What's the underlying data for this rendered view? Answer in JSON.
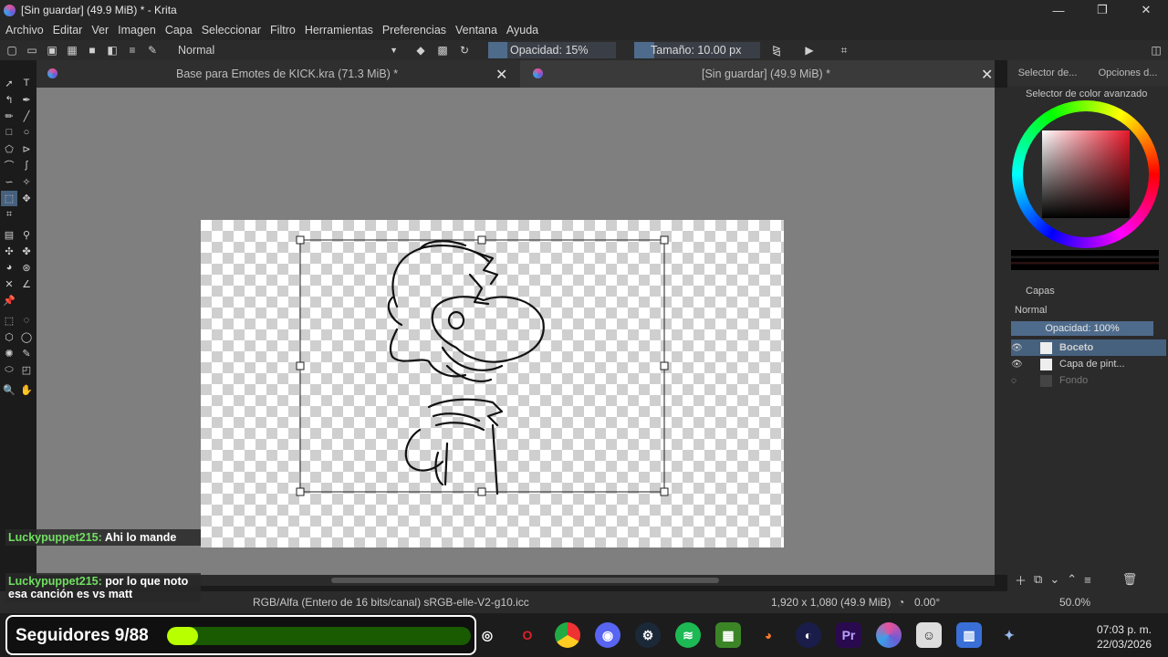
{
  "window": {
    "title": "[Sin guardar]  (49.9 MiB) * - Krita"
  },
  "menu": {
    "items": [
      "Archivo",
      "Editar",
      "Ver",
      "Imagen",
      "Capa",
      "Seleccionar",
      "Filtro",
      "Herramientas",
      "Preferencias",
      "Ventana",
      "Ayuda"
    ]
  },
  "toolbar": {
    "blend_mode": "Normal",
    "opacity_label": "Opacidad: 15%",
    "opacity": 0.15,
    "size_label": "Tamaño: 10.00 px"
  },
  "tabs": [
    {
      "label": "Base para Emotes de KICK.kra (71.3 MiB) *"
    },
    {
      "label": "[Sin guardar]  (49.9 MiB) *"
    }
  ],
  "status": {
    "color_space": "RGB/Alfa (Entero de 16 bits/canal)  sRGB-elle-V2-g10.icc",
    "dimensions": "1,920 x 1,080 (49.9 MiB)",
    "rotation": "0.00°",
    "zoom": "50.0%"
  },
  "dock": {
    "tab1": "Selector de...",
    "tab2": "Opciones d...",
    "color_header": "Selector de color avanzado",
    "layers_header": "Capas",
    "layers_mode": "Normal",
    "layers_opacity": "Opacidad:  100%",
    "layers": [
      {
        "name": "Boceto",
        "selected": true,
        "visible": true
      },
      {
        "name": "Capa de pint...",
        "selected": false,
        "visible": true
      },
      {
        "name": "Fondo",
        "selected": false,
        "visible": false
      }
    ]
  },
  "chat": [
    {
      "user": "Luckypuppet215:",
      "text": " Ahi lo mande"
    },
    {
      "user": "Luckypuppet215:",
      "text": " por lo que noto esa canción es vs matt"
    }
  ],
  "followers": {
    "label": "Seguidores 9/88",
    "current": 9,
    "goal": 88
  },
  "taskbar": {
    "apps": [
      "obs",
      "opera",
      "chrome",
      "discord",
      "steam",
      "spotify",
      "minecraft",
      "blender",
      "cinema4d",
      "premiere",
      "krita",
      "app",
      "store",
      "app2"
    ]
  },
  "clock": {
    "time": "07:03 p. m.",
    "date": "22/03/2026"
  },
  "colors": {
    "accent": "#4e6b8c",
    "selection": "#46617e",
    "follow_bar": "#b8ff00",
    "chat_user": "#70e060"
  }
}
